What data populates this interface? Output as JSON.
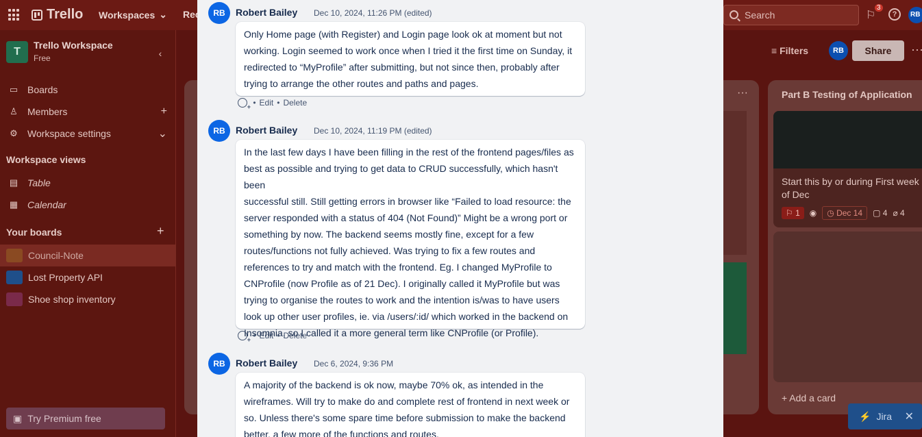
{
  "topbar": {
    "app_name": "Trello",
    "menu_workspaces": "Workspaces",
    "menu_recent": "Rec",
    "search_placeholder": "Search",
    "notif_count": "3",
    "help_glyph": "?",
    "avatar": "RB"
  },
  "sidebar": {
    "workspace_initial": "T",
    "workspace_name": "Trello Workspace",
    "workspace_plan": "Free",
    "items": [
      {
        "label": "Boards",
        "icon": "board-icon"
      },
      {
        "label": "Members",
        "icon": "members-icon"
      },
      {
        "label": "Workspace settings",
        "icon": "gear-icon"
      }
    ],
    "views_title": "Workspace views",
    "views": [
      {
        "label": "Table",
        "icon": "table-icon"
      },
      {
        "label": "Calendar",
        "icon": "calendar-icon"
      }
    ],
    "boards_title": "Your boards",
    "boards": [
      {
        "label": "Council-Note",
        "color": "#a06a2a"
      },
      {
        "label": "Lost Property API",
        "color": "#1f5fa0"
      },
      {
        "label": "Shoe shop inventory",
        "color": "#8a2f55"
      }
    ],
    "premium": "Try Premium free"
  },
  "board": {
    "filters": "Filters",
    "share": "Share",
    "avatar": "RB",
    "list_title": "Part B Testing of Application",
    "card_text": "Start this by or during First week of Dec",
    "card_badge": "1",
    "card_date": "Dec 14",
    "card_comments": "4",
    "card_attach": "4",
    "add_card": "Add a card",
    "jira": "Jira"
  },
  "comments": [
    {
      "initials": "RB",
      "author": "Robert Bailey",
      "time": "Dec 10, 2024, 11:26 PM (edited)",
      "lines": [
        "Only Home page (with Register) and Login page look ok at moment but not",
        "working. Login seemed to work once when I tried it the first time on Sunday,  it",
        "redirected to “MyProfile” after submitting, but not since then, probably after",
        "trying to arrange the other routes and paths and pages."
      ],
      "edit": "Edit",
      "delete": "Delete"
    },
    {
      "initials": "RB",
      "author": "Robert Bailey",
      "time": "Dec 10, 2024, 11:19 PM (edited)",
      "lines": [
        "In the last few days I have been filling in the rest of the frontend pages/files as",
        "best as possible and trying to get data to CRUD successfully, which hasn't been",
        "successful still. Still getting errors in browser like “Failed to load resource: the",
        "server responded with a status of 404 (Not Found)” Might be a wrong port or",
        "something by now. The backend seems mostly fine, except for a few",
        "routes/functions not fully achieved. Was trying to fix a few routes and",
        "references to try and match with the frontend. Eg. I changed MyProfile to",
        "CNProfile (now Profile as of 21 Dec).  I originally called it MyProfile but was",
        "trying to organise the routes to work and the intention is/was to have users",
        "look up other user profiles, ie. via /users/:id/ which worked in the backend on",
        "Insomnia, so I called it a more general term like CNProfile (or Profile)."
      ],
      "edit": "Edit",
      "delete": "Delete"
    },
    {
      "initials": "RB",
      "author": "Robert Bailey",
      "time": "Dec 6, 2024, 9:36 PM",
      "lines": [
        "A majority of the backend is ok now, maybe 70% ok, as intended in the",
        "wireframes. Will try to make do and complete rest of frontend in next week or",
        "so. Unless there's some spare time before submission to make the backend",
        "better, a few more of the functions and routes."
      ]
    }
  ]
}
